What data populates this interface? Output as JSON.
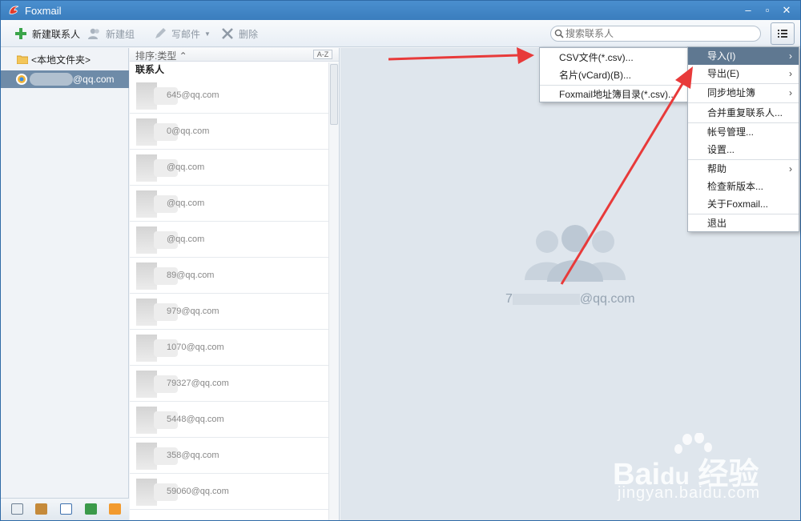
{
  "app": {
    "title": "Foxmail",
    "brand_color": "#3a7dbd"
  },
  "toolbar": {
    "new_contact": "新建联系人",
    "new_group": "新建组",
    "write_mail": "写邮件",
    "delete": "删除",
    "search_placeholder": "搜索联系人"
  },
  "folders": {
    "local": "<本地文件夹>",
    "account_suffix": "@qq.com"
  },
  "list": {
    "sort_label": "排序:类型",
    "az": "A-Z",
    "group_header": "联系人",
    "contacts": [
      {
        "email": "645@qq.com"
      },
      {
        "email": "0@qq.com"
      },
      {
        "email": "@qq.com"
      },
      {
        "email": "@qq.com"
      },
      {
        "email": "@qq.com"
      },
      {
        "email": "89@qq.com"
      },
      {
        "email": "979@qq.com"
      },
      {
        "email": "1070@qq.com"
      },
      {
        "email": "79327@qq.com"
      },
      {
        "email": "5448@qq.com"
      },
      {
        "email": "358@qq.com"
      },
      {
        "email": "59060@qq.com"
      }
    ]
  },
  "right": {
    "account_prefix": "7",
    "account_suffix": "@qq.com"
  },
  "main_menu": {
    "items": [
      {
        "label": "导入(I)",
        "submenu": true,
        "active": true
      },
      {
        "label": "导出(E)",
        "submenu": true
      },
      {
        "label": "同步地址簿",
        "submenu": true
      },
      {
        "label": "合并重复联系人..."
      },
      {
        "label": "帐号管理..."
      },
      {
        "label": "设置..."
      },
      {
        "label": "帮助",
        "submenu": true
      },
      {
        "label": "检查新版本..."
      },
      {
        "label": "关于Foxmail..."
      },
      {
        "label": "退出"
      }
    ]
  },
  "import_submenu": {
    "items": [
      {
        "label": "CSV文件(*.csv)..."
      },
      {
        "label": "名片(vCard)(B)..."
      },
      {
        "label": "Foxmail地址簿目录(*.csv)..."
      }
    ]
  },
  "watermark": {
    "brand": "Bai",
    "brand_cn": "经验",
    "url": "jingyan.baidu.com"
  }
}
